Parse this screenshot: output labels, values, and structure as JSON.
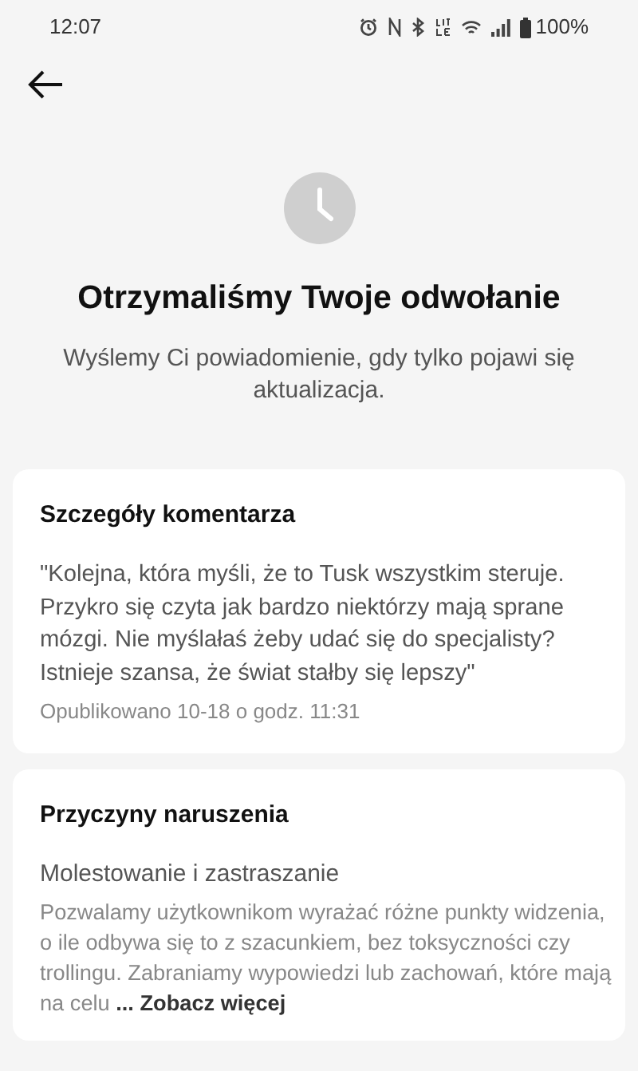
{
  "status_bar": {
    "time": "12:07",
    "battery": "100%"
  },
  "header": {
    "title": "Otrzymaliśmy Twoje odwołanie",
    "subtitle": "Wyślemy Ci powiadomienie, gdy tylko pojawi się aktualizacja."
  },
  "comment_card": {
    "title": "Szczegóły komentarza",
    "comment": "\"Kolejna, która myśli, że to Tusk wszystkim steruje. Przykro się czyta jak bardzo niektórzy mają sprane mózgi. Nie myślałaś żeby udać się do specjalisty? Istnieje szansa, że świat stałby się lepszy\"",
    "published": "Opublikowano 10-18 o godz. 11:31"
  },
  "violation_card": {
    "title": "Przyczyny naruszenia",
    "reason": "Molestowanie i zastraszanie",
    "description": "Pozwalamy użytkownikom wyrażać różne punkty widzenia, o ile odbywa się to z szacunkiem, bez toksyczności czy trollingu. Zabraniamy wypowiedzi lub zachowań, które mają na celu",
    "more_link": "... Zobacz więcej"
  }
}
